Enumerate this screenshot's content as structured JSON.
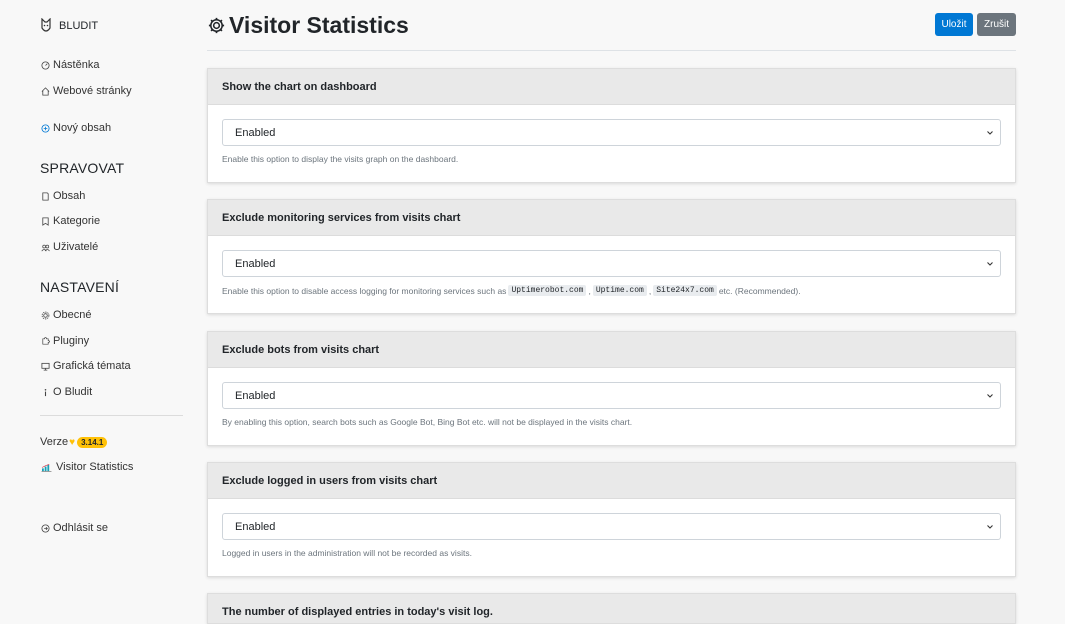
{
  "sidebar": {
    "brand": "BLUDIT",
    "items_top": [
      {
        "label": "Nástěnka",
        "icon": "dashboard-icon"
      },
      {
        "label": "Webové stránky",
        "icon": "home-icon"
      },
      {
        "label": "Nový obsah",
        "icon": "plus-circle-icon"
      }
    ],
    "manage_title": "SPRAVOVAT",
    "manage_items": [
      {
        "label": "Obsah",
        "icon": "file-icon"
      },
      {
        "label": "Kategorie",
        "icon": "bookmark-icon"
      },
      {
        "label": "Uživatelé",
        "icon": "users-icon"
      }
    ],
    "settings_title": "NASTAVENÍ",
    "settings_items": [
      {
        "label": "Obecné",
        "icon": "gear-icon"
      },
      {
        "label": "Pluginy",
        "icon": "puzzle-icon"
      },
      {
        "label": "Grafická témata",
        "icon": "monitor-icon"
      },
      {
        "label": "O Bludit",
        "icon": "info-icon"
      }
    ],
    "version_label": "Verze",
    "version_badge": "3.14.1",
    "plugin_link": "Visitor Statistics",
    "logout": "Odhlásit se"
  },
  "header": {
    "title": "Visitor Statistics",
    "save_label": "Uložit",
    "cancel_label": "Zrušit"
  },
  "colors": {
    "primary": "#0078d4",
    "secondary": "#6c757d",
    "badge": "#ffc107"
  },
  "cards": [
    {
      "title": "Show the chart on dashboard",
      "value": "Enabled",
      "help": "Enable this option to display the visits graph on the dashboard."
    },
    {
      "title": "Exclude monitoring services from visits chart",
      "value": "Enabled",
      "help_pre": "Enable this option to disable access logging for monitoring services such as",
      "code1": "Uptimerobot.com",
      "code2": "Uptime.com",
      "code3": "Site24x7.com",
      "help_post": "etc. (Recommended)."
    },
    {
      "title": "Exclude bots from visits chart",
      "value": "Enabled",
      "help": "By enabling this option, search bots such as Google Bot, Bing Bot etc. will not be displayed in the visits chart."
    },
    {
      "title": "Exclude logged in users from visits chart",
      "value": "Enabled",
      "help": "Logged in users in the administration will not be recorded as visits."
    },
    {
      "title": "The number of displayed entries in today's visit log."
    }
  ]
}
